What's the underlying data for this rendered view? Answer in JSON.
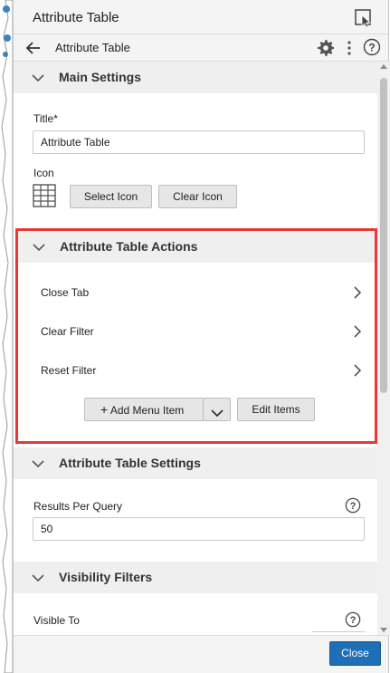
{
  "window": {
    "title": "Attribute Table"
  },
  "nav": {
    "title": "Attribute Table"
  },
  "main_settings": {
    "header": "Main Settings",
    "title_label": "Title*",
    "title_value": "Attribute Table",
    "icon_label": "Icon",
    "select_icon_button": "Select Icon",
    "clear_icon_button": "Clear Icon"
  },
  "actions": {
    "header": "Attribute Table Actions",
    "items": [
      {
        "label": "Close Tab"
      },
      {
        "label": "Clear Filter"
      },
      {
        "label": "Reset Filter"
      }
    ],
    "add_menu_item_button": "Add Menu Item",
    "add_icon_glyph": "+",
    "edit_items_button": "Edit Items",
    "highlight_color": "#e53935"
  },
  "attribute_settings": {
    "header": "Attribute Table Settings",
    "results_label": "Results Per Query",
    "results_value": "50"
  },
  "visibility": {
    "header": "Visibility Filters",
    "visible_to_label": "Visible To"
  },
  "footer": {
    "close_button": "Close",
    "close_color": "#1e6fb5"
  },
  "icons": {
    "pin": "pin-to-corner-icon",
    "back": "back-arrow-icon",
    "settings": "gear-icon",
    "more": "more-vertical-icon",
    "help": "help-icon",
    "collapse": "chevron-down-icon",
    "next": "chevron-right-icon",
    "table": "table-grid-icon"
  }
}
